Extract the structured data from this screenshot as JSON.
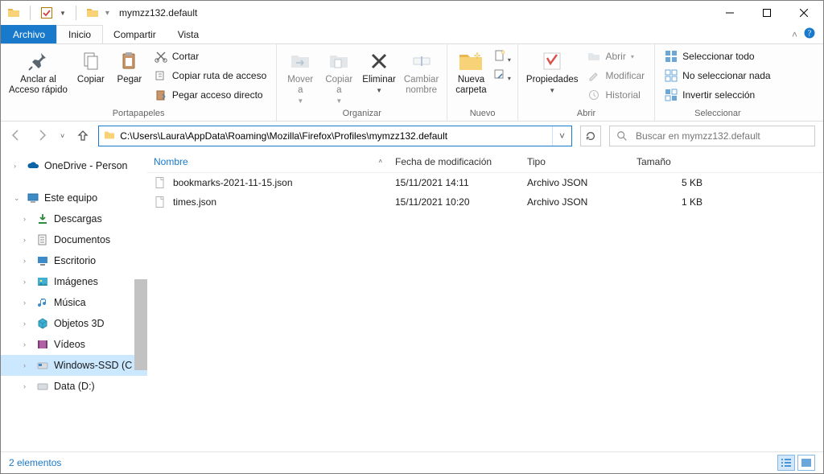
{
  "window": {
    "title": "mymzz132.default"
  },
  "tabs": {
    "file": "Archivo",
    "home": "Inicio",
    "share": "Compartir",
    "view": "Vista"
  },
  "ribbon": {
    "clipboard": {
      "label": "Portapapeles",
      "pin": "Anclar al\nAcceso rápido",
      "copy": "Copiar",
      "paste": "Pegar",
      "cut": "Cortar",
      "copypath": "Copiar ruta de acceso",
      "pasteshortcut": "Pegar acceso directo"
    },
    "organize": {
      "label": "Organizar",
      "moveto": "Mover\na",
      "copyto": "Copiar\na",
      "delete": "Eliminar",
      "rename": "Cambiar\nnombre"
    },
    "new": {
      "label": "Nuevo",
      "newfolder": "Nueva\ncarpeta"
    },
    "open": {
      "label": "Abrir",
      "properties": "Propiedades",
      "open": "Abrir",
      "edit": "Modificar",
      "history": "Historial"
    },
    "select": {
      "label": "Seleccionar",
      "all": "Seleccionar todo",
      "none": "No seleccionar nada",
      "invert": "Invertir selección"
    }
  },
  "address": {
    "path": "C:\\Users\\Laura\\AppData\\Roaming\\Mozilla\\Firefox\\Profiles\\mymzz132.default"
  },
  "search": {
    "placeholder": "Buscar en mymzz132.default"
  },
  "sidebar": {
    "onedrive": "OneDrive - Person",
    "thispc": "Este equipo",
    "downloads": "Descargas",
    "documents": "Documentos",
    "desktop": "Escritorio",
    "pictures": "Imágenes",
    "music": "Música",
    "objects3d": "Objetos 3D",
    "videos": "Vídeos",
    "ssd": "Windows-SSD (C",
    "data": "Data (D:)"
  },
  "columns": {
    "name": "Nombre",
    "modified": "Fecha de modificación",
    "type": "Tipo",
    "size": "Tamaño"
  },
  "files": [
    {
      "name": "bookmarks-2021-11-15.json",
      "modified": "15/11/2021 14:11",
      "type": "Archivo JSON",
      "size": "5 KB"
    },
    {
      "name": "times.json",
      "modified": "15/11/2021 10:20",
      "type": "Archivo JSON",
      "size": "1 KB"
    }
  ],
  "status": {
    "count": "2 elementos"
  }
}
